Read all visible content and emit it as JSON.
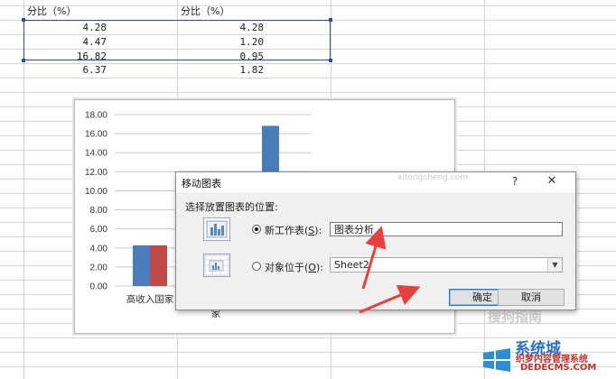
{
  "sheet": {
    "headers": [
      "分比（%）",
      "分比（%）"
    ],
    "col1": [
      "4.28",
      "4.47",
      "16.82",
      "6.37"
    ],
    "col2": [
      "4.28",
      "1.20",
      "0.95",
      "1.82"
    ]
  },
  "chart_data": {
    "type": "bar",
    "categories": [
      "高收入国家"
    ],
    "series": [
      {
        "values": [
          4.28
        ],
        "color": "#4a7ebb"
      },
      {
        "values": [
          4.28
        ],
        "color": "#be4b48"
      }
    ],
    "visible_partial_bar": {
      "value": 16.82,
      "color": "#4a7ebb"
    },
    "yticks": [
      "18.00",
      "16.00",
      "14.00",
      "12.00",
      "10.00",
      "8.00",
      "6.00",
      "4.00",
      "2.00",
      "0.00"
    ],
    "ylim": [
      0,
      18
    ],
    "grid": true,
    "category_fragment": "家"
  },
  "dialog": {
    "title": "移动图表",
    "help": "?",
    "close": "✕",
    "prompt": "选择放置图表的位置:",
    "option_new_sheet": {
      "label": "新工作表",
      "hotkey": "S",
      "selected": true
    },
    "option_object_in": {
      "label": "对象位于",
      "hotkey": "O",
      "selected": false
    },
    "new_sheet_value": "图表分析",
    "object_in_value": "Sheet2",
    "ok": "确定",
    "cancel": "取消"
  },
  "icons": {
    "new_sheet": "chart-sheet-icon",
    "object_in": "chart-object-icon",
    "dropdown": "chevron-down-icon"
  },
  "watermarks": {
    "sogou": "搜狗指南",
    "xitongcheng_small": "xitongcheng.com",
    "xitong": "系统城",
    "dede_cn": "织梦内容管理系统",
    "dede_url": "DEDECMS.COM"
  },
  "colors": {
    "selection": "#2e4aa8",
    "arrow": "#e8413c",
    "ok_border": "#2a78d6"
  }
}
